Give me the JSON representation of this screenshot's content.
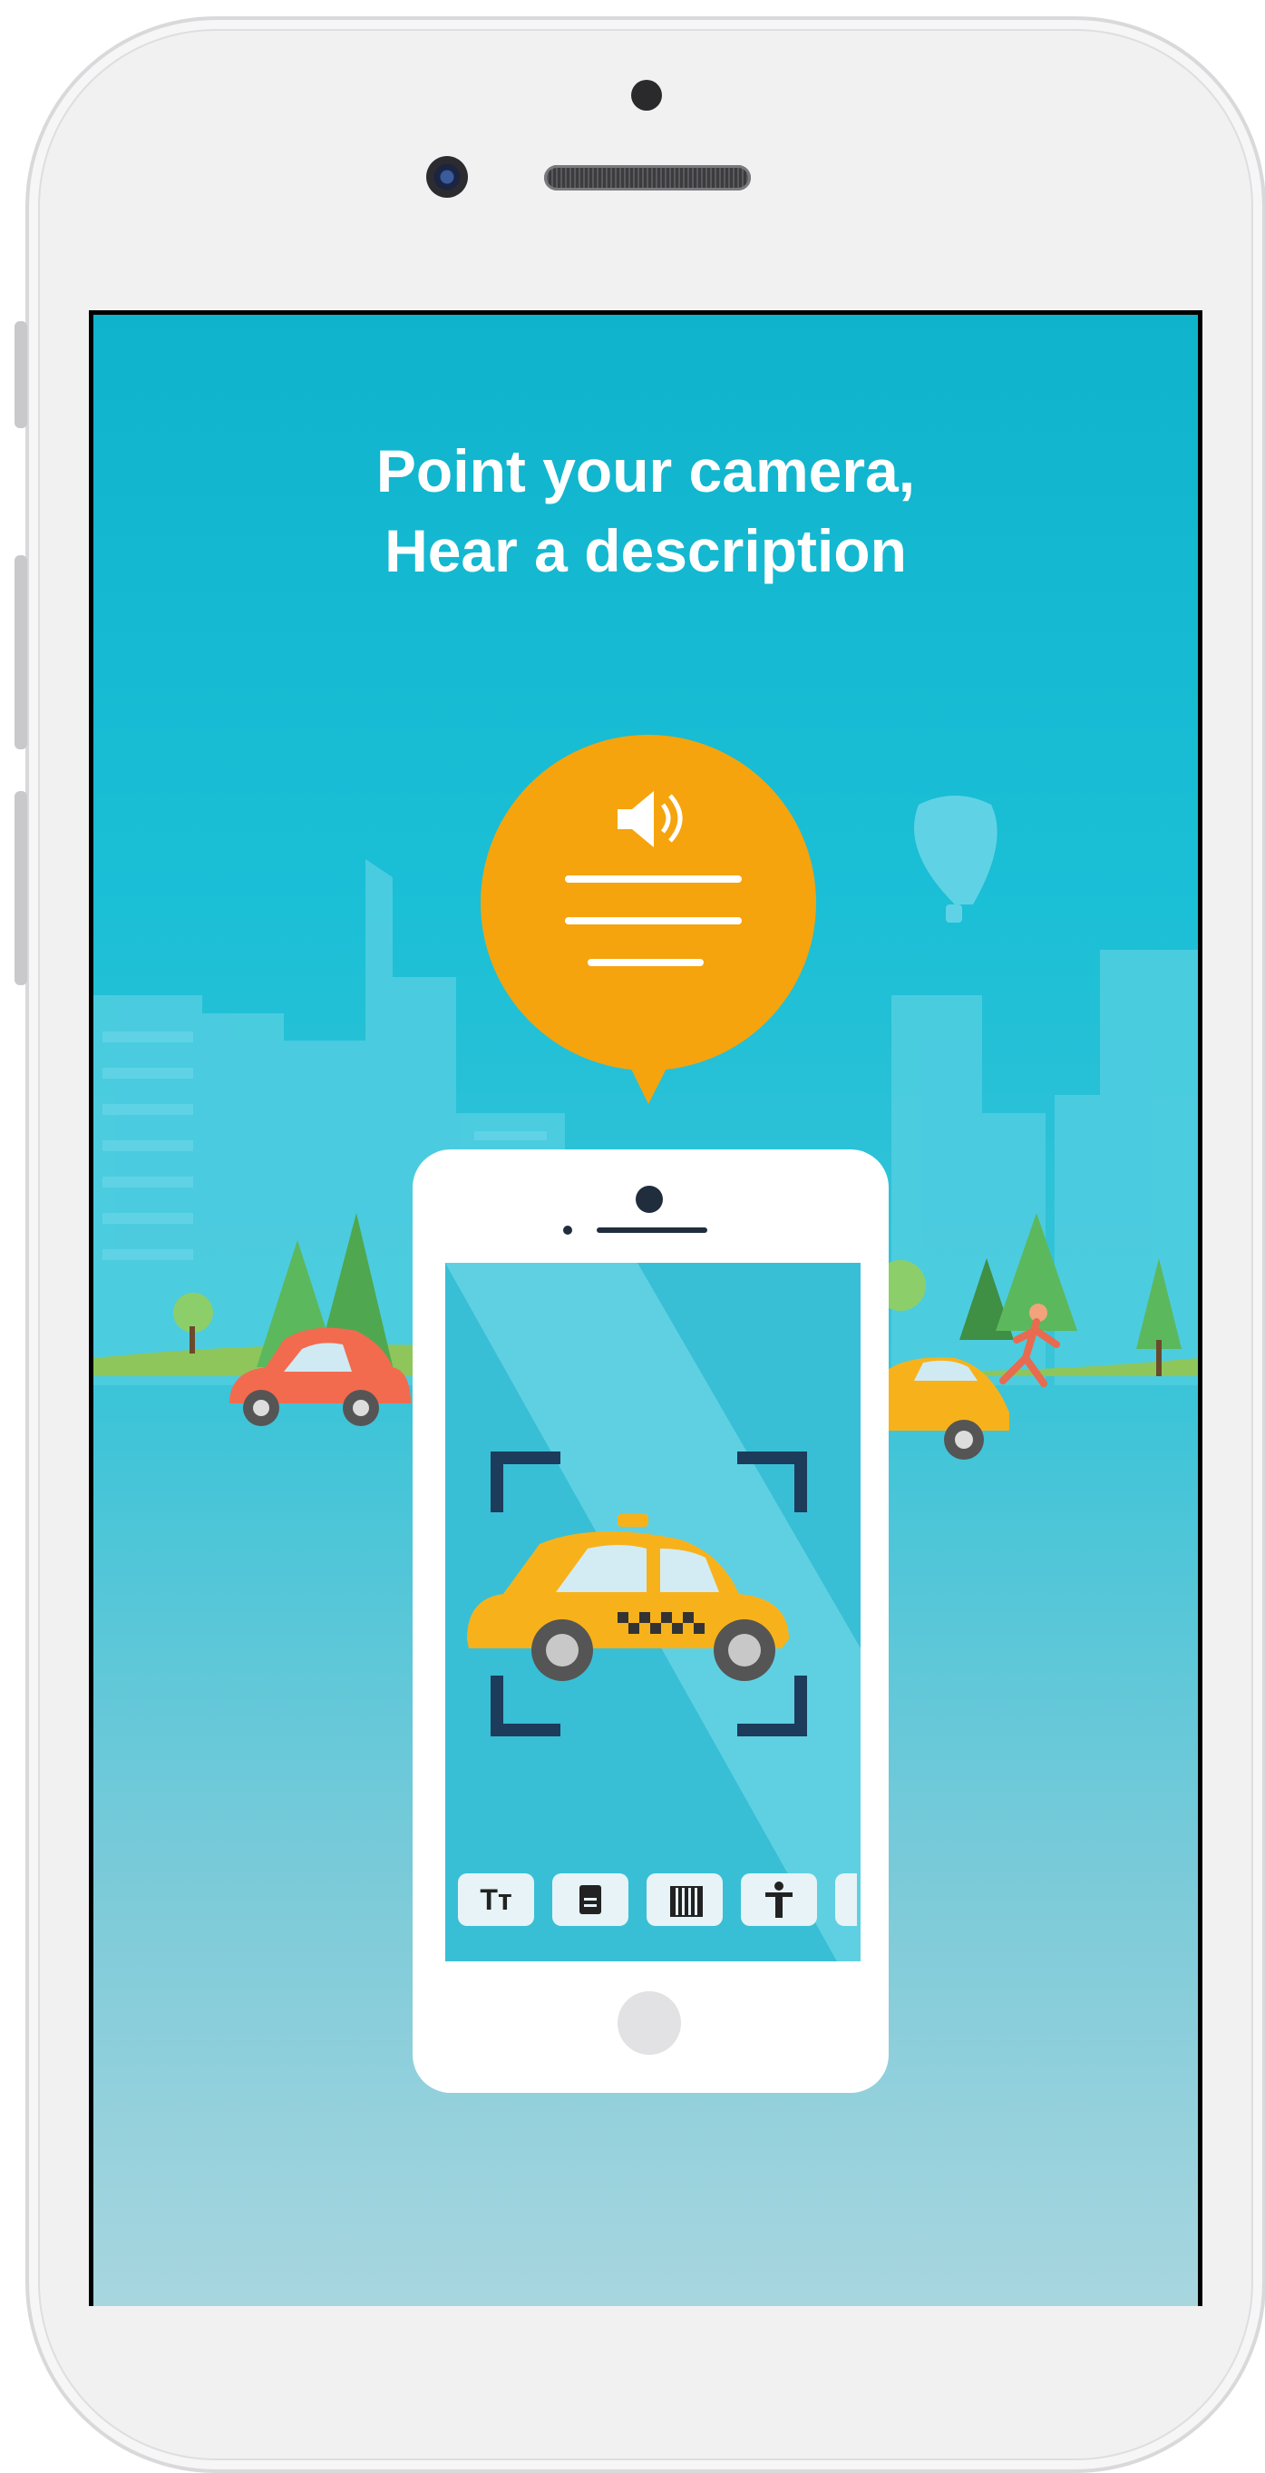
{
  "headline": {
    "line1": "Point your camera,",
    "line2": "Hear a description"
  },
  "illustration": {
    "bubble_icon": "speaker-volume-icon",
    "phone_toolbar_icons": [
      "text-icon",
      "document-icon",
      "barcode-icon",
      "person-icon",
      "more-icon"
    ],
    "phone_toolbar_labels": [
      "Tт",
      "",
      "",
      "",
      ""
    ]
  },
  "colors": {
    "sky_top": "#0fb3cc",
    "sky_bottom": "#a8d6df",
    "bubble": "#f5a40e",
    "taxi": "#f7b21b",
    "red_car": "#f26b4f",
    "tree": "#5cb85c",
    "frame": "#1d3b5a"
  }
}
